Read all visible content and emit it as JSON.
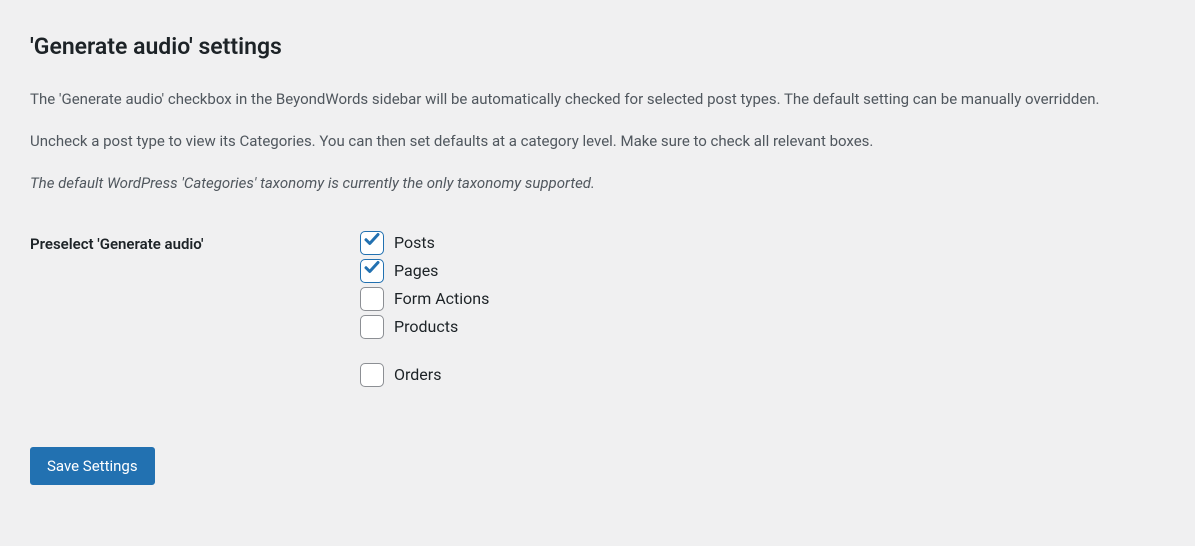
{
  "heading": "'Generate audio' settings",
  "description1": "The 'Generate audio' checkbox in the BeyondWords sidebar will be automatically checked for selected post types. The default setting can be manually overridden.",
  "description2": "Uncheck a post type to view its Categories. You can then set defaults at a category level. Make sure to check all relevant boxes.",
  "description3": "The default WordPress 'Categories' taxonomy is currently the only taxonomy supported.",
  "form": {
    "preselectLabel": "Preselect 'Generate audio'",
    "options": [
      {
        "label": "Posts",
        "checked": true
      },
      {
        "label": "Pages",
        "checked": true
      },
      {
        "label": "Form Actions",
        "checked": false
      },
      {
        "label": "Products",
        "checked": false
      },
      {
        "label": "Orders",
        "checked": false
      }
    ]
  },
  "saveButton": "Save Settings"
}
